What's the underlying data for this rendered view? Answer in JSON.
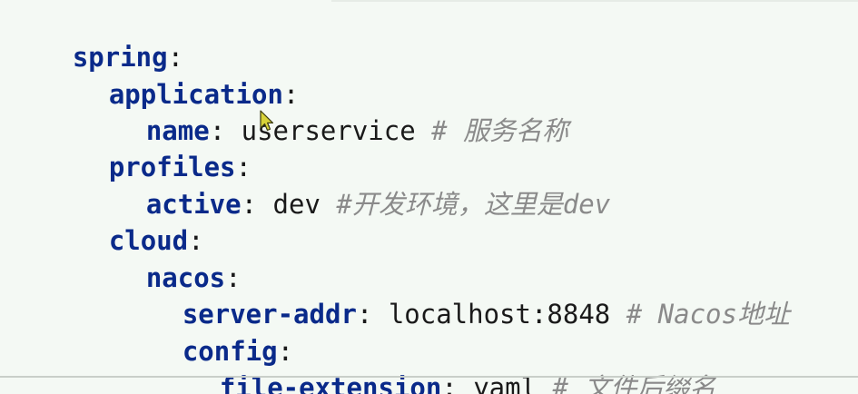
{
  "lines": [
    {
      "indent": 0,
      "key": "spring",
      "value": "",
      "comment": ""
    },
    {
      "indent": 1,
      "key": "application",
      "value": "",
      "comment": ""
    },
    {
      "indent": 2,
      "key": "name",
      "value": "userservice",
      "comment": "# 服务名称"
    },
    {
      "indent": 1,
      "key": "profiles",
      "value": "",
      "comment": ""
    },
    {
      "indent": 2,
      "key": "active",
      "value": "dev",
      "comment": "#开发环境，这里是dev"
    },
    {
      "indent": 1,
      "key": "cloud",
      "value": "",
      "comment": ""
    },
    {
      "indent": 2,
      "key": "nacos",
      "value": "",
      "comment": ""
    },
    {
      "indent": 3,
      "key": "server-addr",
      "value": "localhost:8848",
      "comment": "# Nacos地址"
    },
    {
      "indent": 3,
      "key": "config",
      "value": "",
      "comment": ""
    },
    {
      "indent": 4,
      "key": "file-extension",
      "value": "yaml",
      "comment": "# 文件后缀名"
    }
  ],
  "colors": {
    "background": "#f4f9f4",
    "key": "#0a2a8a",
    "value": "#1a1a1a",
    "comment": "#8a8a8a"
  },
  "cursor_icon": "mouse-pointer-icon"
}
